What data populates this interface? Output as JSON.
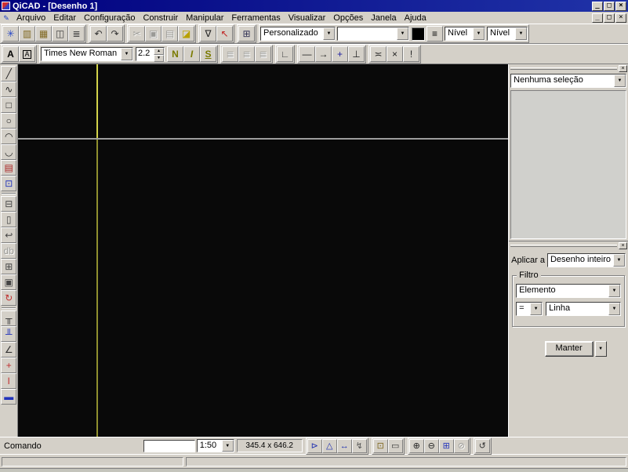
{
  "titlebar": {
    "title": "QiCAD - [Desenho 1]",
    "minimize": "_",
    "restore": "□",
    "close": "×"
  },
  "menubar": {
    "items": [
      "Arquivo",
      "Editar",
      "Configuração",
      "Construir",
      "Manipular",
      "Ferramentas",
      "Visualizar",
      "Opções",
      "Janela",
      "Ajuda"
    ],
    "doc_icon": "✎",
    "minimize": "_",
    "restore": "□",
    "close": "×"
  },
  "toolbar_main": {
    "groups": [
      [
        {
          "name": "new-drawing-icon",
          "glyph": "✳",
          "color": "#2848c8"
        },
        {
          "name": "open-drawing-icon",
          "glyph": "▥",
          "color": "#806820"
        },
        {
          "name": "save-icon",
          "glyph": "▦",
          "color": "#806820"
        },
        {
          "name": "print-preview-icon",
          "glyph": "◫",
          "color": "#444444"
        },
        {
          "name": "print-icon",
          "glyph": "≣",
          "color": "#444444"
        }
      ],
      [
        {
          "name": "undo-icon",
          "glyph": "↶",
          "color": "#333333"
        },
        {
          "name": "redo-icon",
          "glyph": "↷",
          "color": "#333333"
        }
      ],
      [
        {
          "name": "cut-icon",
          "glyph": "✂",
          "disabled": true
        },
        {
          "name": "copy-icon",
          "glyph": "▣",
          "disabled": true
        },
        {
          "name": "paste-icon",
          "glyph": "▤",
          "disabled": true
        },
        {
          "name": "erase-icon",
          "glyph": "◪",
          "color": "#b8a000"
        }
      ],
      [
        {
          "name": "filter-icon",
          "glyph": "∇",
          "color": "#222222"
        },
        {
          "name": "select-special-icon",
          "glyph": "↖",
          "color": "#c02020"
        }
      ],
      [
        {
          "name": "properties-icon",
          "glyph": "⊞",
          "color": "#333355"
        }
      ]
    ],
    "style_combo": "Personalizado",
    "empty_combo": "",
    "color_swatch": "#000000",
    "layers_icon": "≡",
    "level_combo_1": "Nível",
    "level_combo_2": "Nível",
    "dropdown_arrow": "▼"
  },
  "toolbar_text": {
    "a_icons": [
      {
        "name": "text-color-icon",
        "glyph": "A",
        "cls": "bold"
      },
      {
        "name": "text-style-icon",
        "glyph": "A",
        "cls": "boxed"
      }
    ],
    "font_combo": "Times New Roman",
    "size_value": "2.2",
    "nis_icons": [
      {
        "name": "bold-icon",
        "glyph": "N",
        "color": "#7a7a00",
        "cls": "bold"
      },
      {
        "name": "italic-icon",
        "glyph": "I",
        "color": "#7a7a00",
        "cls": "italic bold"
      },
      {
        "name": "underline-icon",
        "glyph": "S",
        "color": "#7a7a00",
        "cls": "underline bold"
      }
    ],
    "align_icons": [
      {
        "name": "align-left-icon",
        "glyph": "≣",
        "disabled": true
      },
      {
        "name": "align-center-icon",
        "glyph": "≣",
        "disabled": true
      },
      {
        "name": "align-right-icon",
        "glyph": "≣",
        "disabled": true
      }
    ],
    "baseline_icons": [
      {
        "name": "text-baseline-icon",
        "glyph": "∟",
        "color": "#444444"
      }
    ],
    "marker_icons": [
      {
        "name": "line-style-icon",
        "glyph": "—",
        "color": "#222222"
      },
      {
        "name": "arrow-style-icon",
        "glyph": "→",
        "color": "#222222"
      },
      {
        "name": "cross-marker-icon",
        "glyph": "+",
        "color": "#2020a0"
      },
      {
        "name": "tick-marker-icon",
        "glyph": "⊥",
        "color": "#222222"
      }
    ],
    "end_icons": [
      {
        "name": "segment-marks-icon",
        "glyph": "≍",
        "color": "#222222"
      },
      {
        "name": "cross-icon",
        "glyph": "×",
        "color": "#222222"
      },
      {
        "name": "exclamation-icon",
        "glyph": "!",
        "color": "#222222"
      }
    ]
  },
  "left_toolbar": {
    "groups": [
      [
        {
          "name": "line-tool-icon",
          "glyph": "╱",
          "color": "#222222"
        },
        {
          "name": "polyline-tool-icon",
          "glyph": "∿",
          "color": "#222222"
        },
        {
          "name": "rectangle-tool-icon",
          "glyph": "□",
          "color": "#222222"
        },
        {
          "name": "circle-tool-icon",
          "glyph": "○",
          "color": "#222222"
        },
        {
          "name": "arc-tool-icon",
          "glyph": "◠",
          "color": "#222222"
        },
        {
          "name": "curve-tool-icon",
          "glyph": "◡",
          "color": "#222222"
        },
        {
          "name": "text-tool-icon",
          "glyph": "▤",
          "color": "#aa2222"
        },
        {
          "name": "block-insert-tool-icon",
          "glyph": "⊡",
          "color": "#2233bb"
        }
      ],
      [
        {
          "name": "trim-tool-icon",
          "glyph": "⊟",
          "color": "#444444"
        },
        {
          "name": "extend-tool-icon",
          "glyph": "▯",
          "color": "#444444"
        },
        {
          "name": "offset-tool-icon",
          "glyph": "↩",
          "color": "#444444"
        },
        {
          "name": "parallel-copy-tool-icon",
          "glyph": "db",
          "disabled": true
        },
        {
          "name": "copy-tool-icon",
          "glyph": "⊞",
          "color": "#444444"
        },
        {
          "name": "duplicate-tool-icon",
          "glyph": "▣",
          "color": "#444444"
        },
        {
          "name": "rotate-tool-icon",
          "glyph": "↻",
          "color": "#c03030"
        }
      ],
      [
        {
          "name": "dim-horizontal-tool-icon",
          "glyph": "╥",
          "color": "#333333"
        },
        {
          "name": "dim-vertical-tool-icon",
          "glyph": "╨",
          "color": "#2233bb"
        },
        {
          "name": "dim-angle-tool-icon",
          "glyph": "∠",
          "color": "#333333"
        },
        {
          "name": "dim-marker-tool-icon",
          "glyph": "+",
          "color": "#c03030"
        },
        {
          "name": "dim-level-tool-icon",
          "glyph": "I",
          "color": "#c03030"
        },
        {
          "name": "leader-tool-icon",
          "glyph": "▬",
          "color": "#2233bb"
        }
      ]
    ]
  },
  "canvas": {
    "crosshair_color_top": "#d2d24a",
    "crosshair_color_bottom": "#8f8f2e",
    "guide_color": "#9c9c9c",
    "background": "#090909"
  },
  "right_top_panel": {
    "close": "×",
    "selection_combo": "Nenhuma seleção",
    "dropdown_arrow": "▼"
  },
  "right_bottom_panel": {
    "close": "×",
    "apply_label": "Aplicar a",
    "apply_combo": "Desenho inteiro",
    "filter_group_label": "Filtro",
    "element_combo": "Elemento",
    "operator_combo": "=",
    "type_combo": "Linha",
    "keep_button": "Manter",
    "keep_more": "▼",
    "dropdown_arrow": "▼"
  },
  "command_bar": {
    "label": "Comando",
    "input_value": "",
    "scale_combo": "1:50",
    "coords": "345.4 x 646.2",
    "dropdown_arrow": "▼",
    "groups": [
      [
        {
          "name": "snap-nearest-icon",
          "glyph": "⊳",
          "color": "#2030b0"
        },
        {
          "name": "snap-angle-icon",
          "glyph": "△",
          "color": "#2030b0"
        },
        {
          "name": "snap-distance-icon",
          "glyph": "↔",
          "color": "#2030b0"
        },
        {
          "name": "snap-tools-icon",
          "glyph": "↯",
          "color": "#555555"
        }
      ],
      [
        {
          "name": "view-region-icon",
          "glyph": "⊡",
          "color": "#806820"
        },
        {
          "name": "view-window-icon",
          "glyph": "▭",
          "color": "#333333"
        }
      ],
      [
        {
          "name": "zoom-in-icon",
          "glyph": "⊕",
          "color": "#222222"
        },
        {
          "name": "zoom-out-icon",
          "glyph": "⊖",
          "color": "#222222"
        },
        {
          "name": "zoom-window-icon",
          "glyph": "⊞",
          "color": "#2233bb"
        },
        {
          "name": "zoom-previous-icon",
          "glyph": "⊘",
          "disabled": true
        }
      ],
      [
        {
          "name": "redraw-icon",
          "glyph": "↺",
          "color": "#333333"
        }
      ]
    ]
  }
}
